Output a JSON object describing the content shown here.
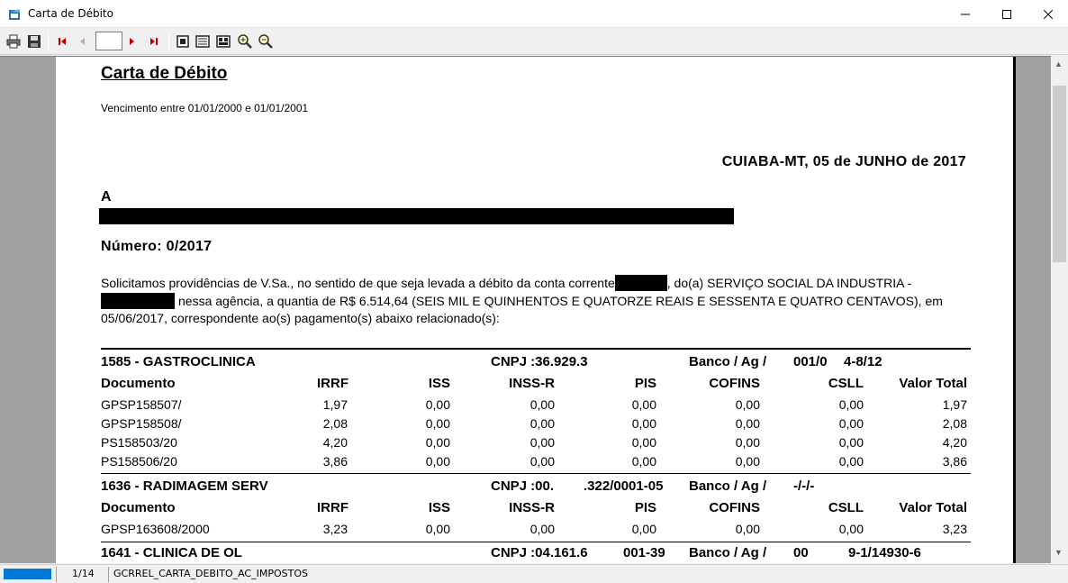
{
  "window": {
    "title": "Carta de Débito",
    "minimize": "─",
    "maximize": "☐",
    "close": "✕"
  },
  "toolbar": {
    "page_value": "",
    "icons": [
      "printer-icon",
      "save-icon",
      "first-page-icon",
      "prev-page-icon",
      "next-page-icon",
      "last-page-icon",
      "one-page-icon",
      "page-width-icon",
      "multi-page-icon",
      "zoom-in-icon",
      "zoom-out-icon"
    ]
  },
  "status": {
    "page_count": "1/14",
    "report_name": "GCRREL_CARTA_DEBITO_AC_IMPOSTOS"
  },
  "doc": {
    "title": "Carta de Débito",
    "subtitle": "Vencimento entre 01/01/2000 e 01/01/2001",
    "date_line": "CUIABA-MT, 05 de JUNHO de 2017",
    "addressee": "A",
    "number": "Número: 0/2017",
    "para1a": "Solicitamos providências de V.Sa., no sentido de que seja levada a débito da conta corrente",
    "para1b": ", do(a) SERVIÇO SOCIAL DA INDUSTRIA -",
    "para2": "nessa agência, a quantia de R$ 6.514,64 (SEIS MIL E QUINHENTOS E QUATORZE REAIS E SESSENTA E QUATRO CENTAVOS), em",
    "para3": "05/06/2017, correspondente ao(s) pagamento(s) abaixo relacionado(s):"
  },
  "columns": [
    "Documento",
    "IRRF",
    "ISS",
    "INSS-R",
    "PIS",
    "COFINS",
    "CSLL",
    "Valor Total"
  ],
  "groups": [
    {
      "name": "1585 - GASTROCLINICA",
      "cnpj_label": "CNPJ :36.929.3",
      "cnpj_rest": "",
      "banco_label": "Banco / Ag /",
      "banco_a": "001/0",
      "banco_b": "4-8/12",
      "rows": [
        [
          "GPSP158507/",
          "1,97",
          "0,00",
          "0,00",
          "0,00",
          "0,00",
          "0,00",
          "1,97"
        ],
        [
          "GPSP158508/",
          "2,08",
          "0,00",
          "0,00",
          "0,00",
          "0,00",
          "0,00",
          "2,08"
        ],
        [
          "PS158503/20",
          "4,20",
          "0,00",
          "0,00",
          "0,00",
          "0,00",
          "0,00",
          "4,20"
        ],
        [
          "PS158506/20",
          "3,86",
          "0,00",
          "0,00",
          "0,00",
          "0,00",
          "0,00",
          "3,86"
        ]
      ]
    },
    {
      "name": "1636 - RADIMAGEM SERV",
      "cnpj_label": "CNPJ :00.",
      "cnpj_rest": ".322/0001-05",
      "banco_label": "Banco / Ag /",
      "banco_a": "-/-/-",
      "banco_b": "",
      "rows": [
        [
          "GPSP163608/2000",
          "3,23",
          "0,00",
          "0,00",
          "0,00",
          "0,00",
          "0,00",
          "3,23"
        ]
      ]
    },
    {
      "name": "1641 - CLINICA DE OL",
      "cnpj_label": "CNPJ :04.161.6",
      "cnpj_rest": "001-39",
      "banco_label": "Banco / Ag /",
      "banco_a": "00",
      "banco_b": "9-1/14930-6",
      "rows": []
    }
  ]
}
